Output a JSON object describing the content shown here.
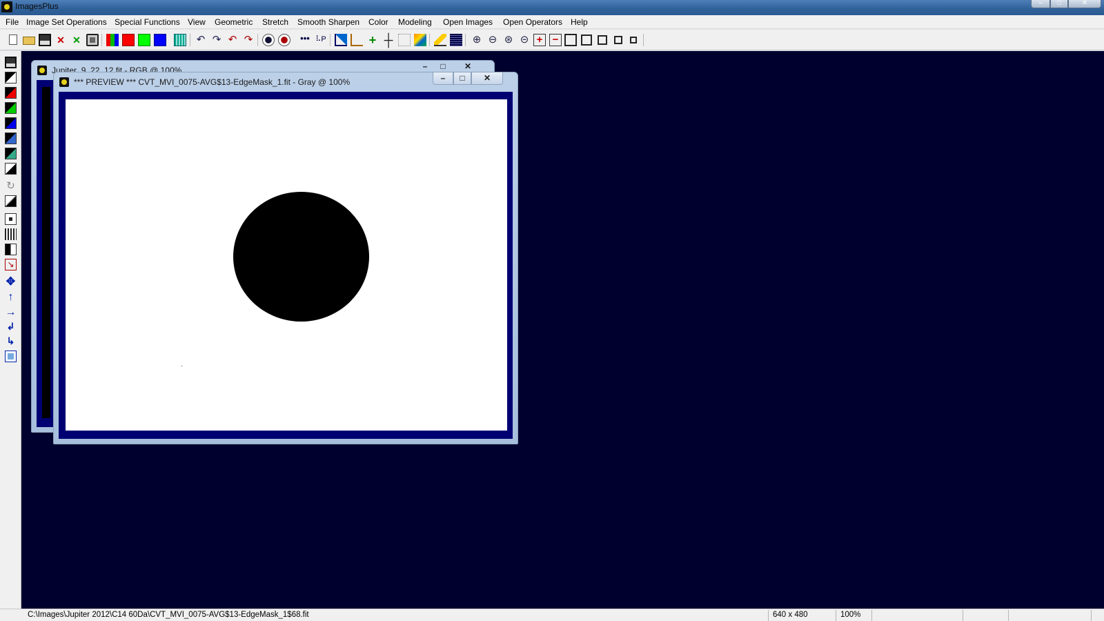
{
  "app": {
    "title": "ImagesPlus"
  },
  "window_controls": {
    "minimize": "–",
    "maximize": "□",
    "close": "✕"
  },
  "menu": [
    "File",
    "Image Set Operations",
    "Special Functions",
    "View",
    "Geometric",
    "Stretch",
    "Smooth Sharpen",
    "Color",
    "Modeling",
    "Open Images",
    "Open Operators",
    "Help"
  ],
  "toolbar_icons": [
    "new-file-icon",
    "open-folder-icon",
    "save-icon",
    "close-x-icon",
    "close-all-icon",
    "print-icon",
    "rgb-channels-icon",
    "red-channel-icon",
    "green-channel-icon",
    "blue-channel-icon",
    "grid-icon",
    "undo-icon",
    "redo-icon",
    "undo-all-icon",
    "redo-all-icon",
    "star-mask-icon",
    "red-dot-icon",
    "dots-icon",
    "plot-icon",
    "histogram-icon",
    "axis-icon",
    "plus-icon",
    "crosshair-icon",
    "marquee-icon",
    "image-color-icon",
    "pencil-icon",
    "lines-icon",
    "zoom-in-icon",
    "zoom-out-icon",
    "zoom-fit-icon",
    "zoom-reset-icon",
    "zoom-plus-icon",
    "zoom-minus-icon",
    "frame-large-icon",
    "frame-medium-icon",
    "frame-small-icon",
    "frame-xsmall-icon",
    "frame-tiny-icon"
  ],
  "left_toolbar_icons": [
    "save-icon",
    "layer-icon",
    "red-layer-icon",
    "green-layer-icon",
    "blue-layer-icon",
    "rgb-layer-icon",
    "color-layer-icon",
    "invert-icon",
    "clockwise-icon",
    "gradient-icon",
    "select-icon",
    "levels-icon",
    "black-bar-icon",
    "crop-arrow-icon",
    "move-icon",
    "up-arrow-icon",
    "right-arrow-icon",
    "rotate-left-icon",
    "rotate-right-icon",
    "copy-icon"
  ],
  "windows": {
    "back": {
      "title": "Jupiter_9_22_12.fit - RGB @ 100%"
    },
    "front": {
      "title": "*** PREVIEW *** CVT_MVI_0075-AVG$13-EdgeMask_1.fit - Gray @ 100%"
    }
  },
  "status": {
    "path": "C:\\Images\\Jupiter 2012\\C14 60Da\\CVT_MVI_0075-AVG$13-EdgeMask_1$68.fit",
    "dimensions": "640 x 480",
    "zoom": "100%"
  },
  "colors": {
    "mdi_background": "#00002e",
    "image_border": "#000072"
  }
}
